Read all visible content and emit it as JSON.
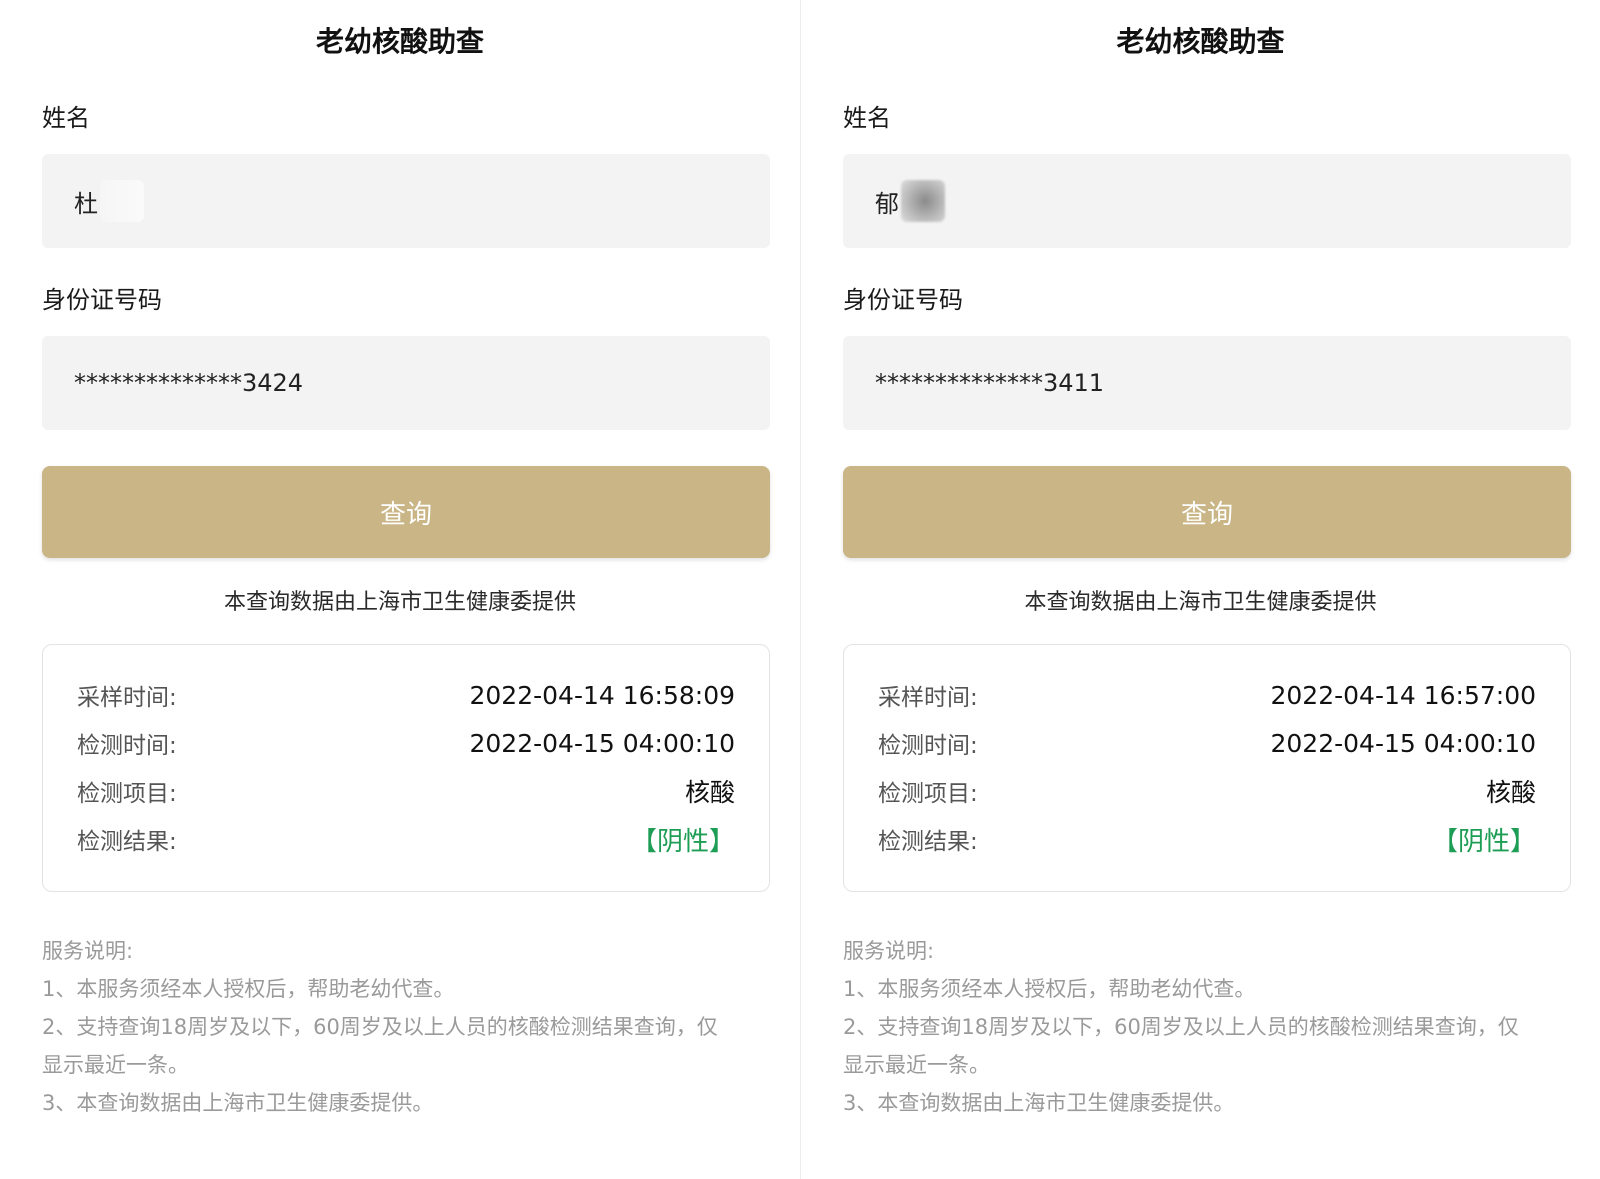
{
  "panels": [
    {
      "title": "老幼核酸助查",
      "name_label": "姓名",
      "name_value": "杜",
      "id_label": "身份证号码",
      "id_value": "**************3424",
      "query_button": "查询",
      "provider_note": "本查询数据由上海市卫生健康委提供",
      "results": [
        {
          "label": "采样时间:",
          "value": "2022-04-14 16:58:09"
        },
        {
          "label": "检测时间:",
          "value": "2022-04-15 04:00:10"
        },
        {
          "label": "检测项目:",
          "value": "核酸"
        },
        {
          "label": "检测结果:",
          "value": "【阴性】"
        }
      ],
      "service_notes": {
        "heading": "服务说明:",
        "line1": "1、本服务须经本人授权后，帮助老幼代查。",
        "line2a": "2、支持查询18周岁及以下，60周岁及以上人员的核酸检测结果查询，仅",
        "line2b": "显示最近一条。",
        "line3": "3、本查询数据由上海市卫生健康委提供。"
      }
    },
    {
      "title": "老幼核酸助查",
      "name_label": "姓名",
      "name_value": "郁",
      "id_label": "身份证号码",
      "id_value": "**************3411",
      "query_button": "查询",
      "provider_note": "本查询数据由上海市卫生健康委提供",
      "results": [
        {
          "label": "采样时间:",
          "value": "2022-04-14 16:57:00"
        },
        {
          "label": "检测时间:",
          "value": "2022-04-15 04:00:10"
        },
        {
          "label": "检测项目:",
          "value": "核酸"
        },
        {
          "label": "检测结果:",
          "value": "【阴性】"
        }
      ],
      "service_notes": {
        "heading": "服务说明:",
        "line1": "1、本服务须经本人授权后，帮助老幼代查。",
        "line2a": "2、支持查询18周岁及以下，60周岁及以上人员的核酸检测结果查询，仅",
        "line2b": "显示最近一条。",
        "line3": "3、本查询数据由上海市卫生健康委提供。"
      }
    }
  ],
  "colors": {
    "button": "#c9b585",
    "negative_result": "#1e9e55",
    "input_background": "#f3f3f3"
  }
}
